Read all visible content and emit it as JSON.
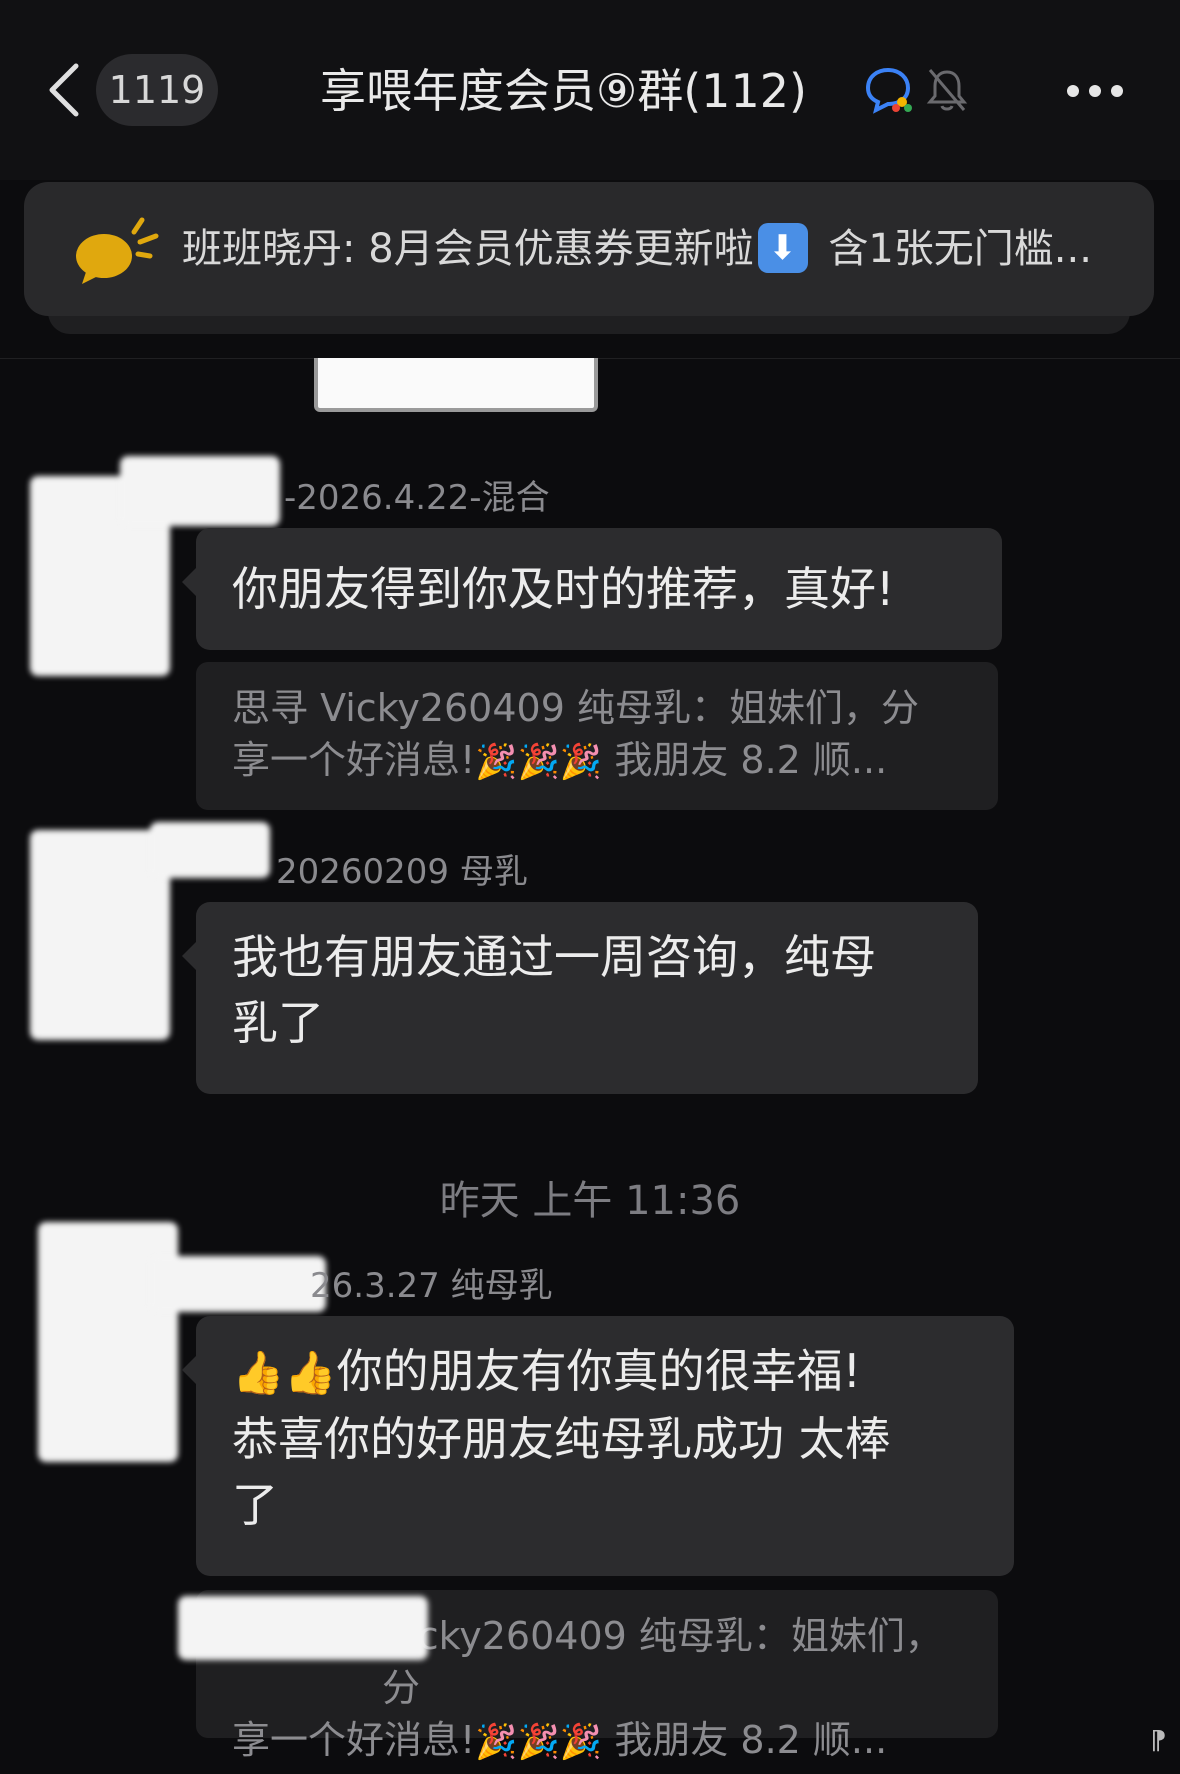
{
  "header": {
    "unread_count": "1119",
    "group_title": "享喂年度会员⑨群(112)"
  },
  "announcement": {
    "text": "班班晓丹: 8月会员优惠券更新啦",
    "text_after": " 含1张无门槛..."
  },
  "messages": [
    {
      "name_suffix": "-2026.4.22-混合",
      "text": "你朋友得到你及时的推荐，真好!",
      "quote_line1": "思寻 Vicky260409 纯母乳：姐妹们，分",
      "quote_line2_start": "享一个好消息!",
      "quote_line2_end": " 我朋友 8.2 顺..."
    },
    {
      "name_suffix": "20260209  母乳",
      "text_line1": "我也有朋友通过一周咨询，纯母",
      "text_line2": "乳了"
    },
    {
      "timestamp": "昨天 上午 11:36"
    },
    {
      "name_suffix": "26.3.27 纯母乳",
      "text_line1": "你的朋友有你真的很幸福!",
      "text_line2": "恭喜你的好朋友纯母乳成功 太棒",
      "text_line3": "了",
      "quote_line1": "Vicky260409 纯母乳：姐妹们，分",
      "quote_line2_start": "享一个好消息!",
      "quote_line2_end": " 我朋友 8.2 顺..."
    }
  ],
  "icons": {
    "back": "chevron-left-icon",
    "chat_bubble": "group-chat-icon",
    "mute": "bell-off-icon",
    "more": "more-dots-icon",
    "announcement": "megaphone-icon",
    "party": "party-popper-emoji",
    "thumbs_up": "thumbs-up-emoji"
  },
  "colors": {
    "background": "#0c0c0e",
    "bubble": "#2c2c2e",
    "quote": "#1f1f21",
    "announcement_accent": "#e0a80e"
  }
}
